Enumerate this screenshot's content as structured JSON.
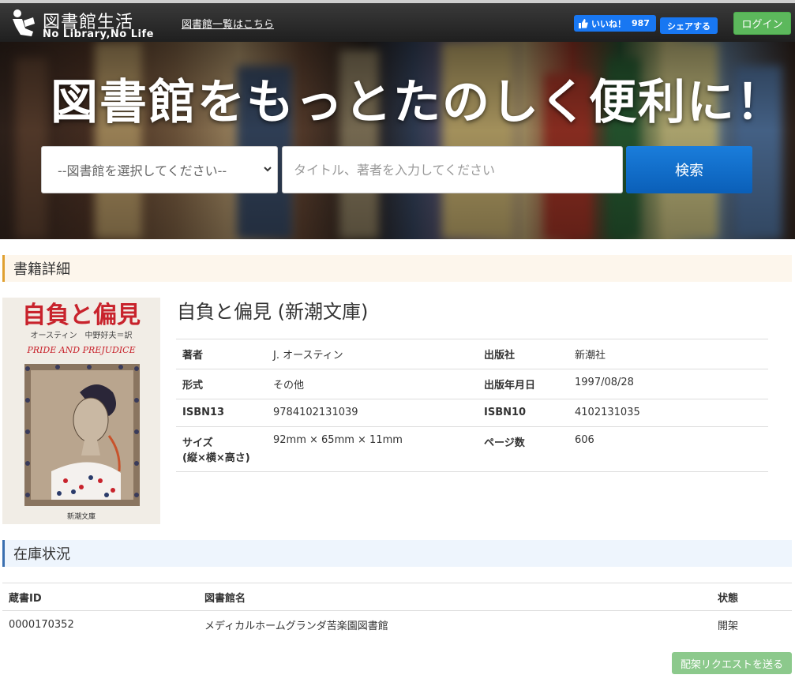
{
  "header": {
    "logo_title": "図書館生活",
    "logo_subtitle": "No Library,No Life",
    "library_list_link": "図書館一覧はこちら",
    "like_label": "いいね！",
    "like_count": "987",
    "share_label": "シェアする",
    "login_label": "ログイン"
  },
  "hero": {
    "title": "図書館をもっとたのしく便利に！",
    "library_select": "--図書館を選択してください--",
    "search_placeholder": "タイトル、著者を入力してください",
    "search_button": "検索"
  },
  "detail_section": {
    "heading": "書籍詳細",
    "book_title": "自負と偏見 (新潮文庫)",
    "cover": {
      "title": "自負と偏見",
      "credits": "オースティン　中野好夫＝訳",
      "english_title": "PRIDE AND PREJUDICE",
      "publisher_mark": "新潮文庫"
    },
    "rows": [
      {
        "k1": "著者",
        "v1": "J. オースティン",
        "k2": "出版社",
        "v2": "新潮社"
      },
      {
        "k1": "形式",
        "v1": "その他",
        "k2": "出版年月日",
        "v2": "1997/08/28"
      },
      {
        "k1": "ISBN13",
        "v1": "9784102131039",
        "k2": "ISBN10",
        "v2": "4102131035"
      },
      {
        "k1": "サイズ",
        "k1b": "(縦×横×高さ)",
        "v1": "92mm × 65mm × 11mm",
        "k2": "ページ数",
        "v2": "606"
      }
    ]
  },
  "stock_section": {
    "heading": "在庫状況",
    "columns": [
      "蔵書ID",
      "図書館名",
      "状態"
    ],
    "rows": [
      {
        "id": "0000170352",
        "library": "メディカルホームグランダ苦楽園図書館",
        "status": "開架"
      }
    ],
    "request_button": "配架リクエストを送る"
  },
  "colors": {
    "topbar": "#2b2b2b",
    "facebook": "#1877f2",
    "login": "#5cb85c",
    "search_button": "#0a6fd0",
    "detail_accent": "#e0a030",
    "stock_accent": "#3a6fb0",
    "request_button": "#8cc98c"
  },
  "icons": {
    "logo": "reading-person-icon",
    "like": "thumbs-up-icon",
    "select": "chevron-down-icon"
  }
}
